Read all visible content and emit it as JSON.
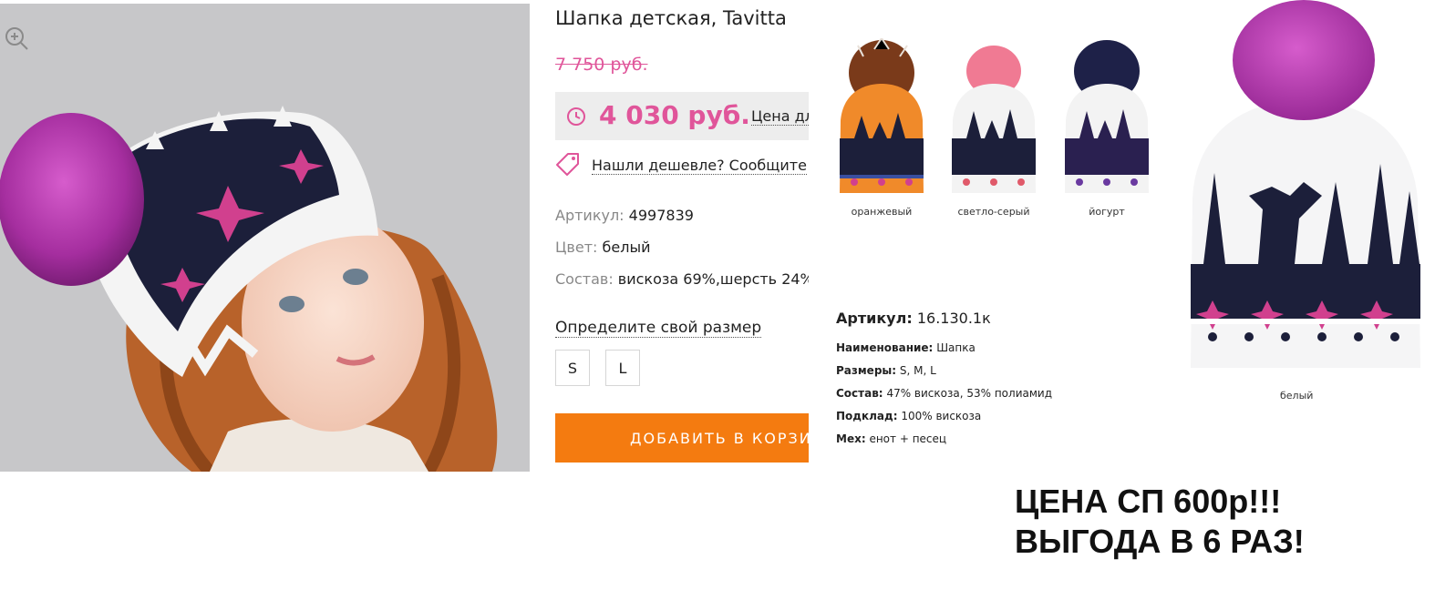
{
  "product": {
    "title": "Шапка детская, Tavitta",
    "old_price": "7 750 руб.",
    "price": "4 030 руб.",
    "price_note": "Цена дл",
    "cheaper_link": "Нашли дешевле? Сообщите",
    "specs": [
      {
        "key": "Артикул:",
        "value": "4997839"
      },
      {
        "key": "Цвет:",
        "value": "белый"
      },
      {
        "key": "Состав:",
        "value": "вискоза 69%,шерсть 24%"
      }
    ],
    "size_link": "Определите свой размер",
    "sizes": [
      "S",
      "L"
    ],
    "cart_button": "ДОБАВИТЬ В КОРЗИНУ"
  },
  "catalog": {
    "variants": [
      {
        "label": "оранжевый",
        "pompom": "#7a3a1a",
        "band": "#f08a2a"
      },
      {
        "label": "светло-серый",
        "pompom": "#f07a93",
        "band": "#ffffff"
      },
      {
        "label": "йогурт",
        "pompom": "#1e2148",
        "band": "#ffffff"
      }
    ],
    "article_key": "Артикул:",
    "article_value": "16.130.1к",
    "specs": [
      {
        "key": "Наименование:",
        "value": "Шапка"
      },
      {
        "key": "Размеры:",
        "value": "S, M, L"
      },
      {
        "key": "Состав:",
        "value": "47% вискоза, 53% полиамид"
      },
      {
        "key": "Подклад:",
        "value": "100% вискоза"
      },
      {
        "key": "Мех:",
        "value": "енот + песец"
      }
    ],
    "big_label": "белый"
  },
  "promo": {
    "line1": "ЦЕНА СП 600р!!!",
    "line2": "ВЫГОДА В 6 РАЗ!"
  },
  "colors": {
    "accent_pink": "#e0559a",
    "cart_orange": "#f47b10",
    "hat_navy": "#1c1f3a",
    "pompom_magenta": "#b53ab0"
  }
}
